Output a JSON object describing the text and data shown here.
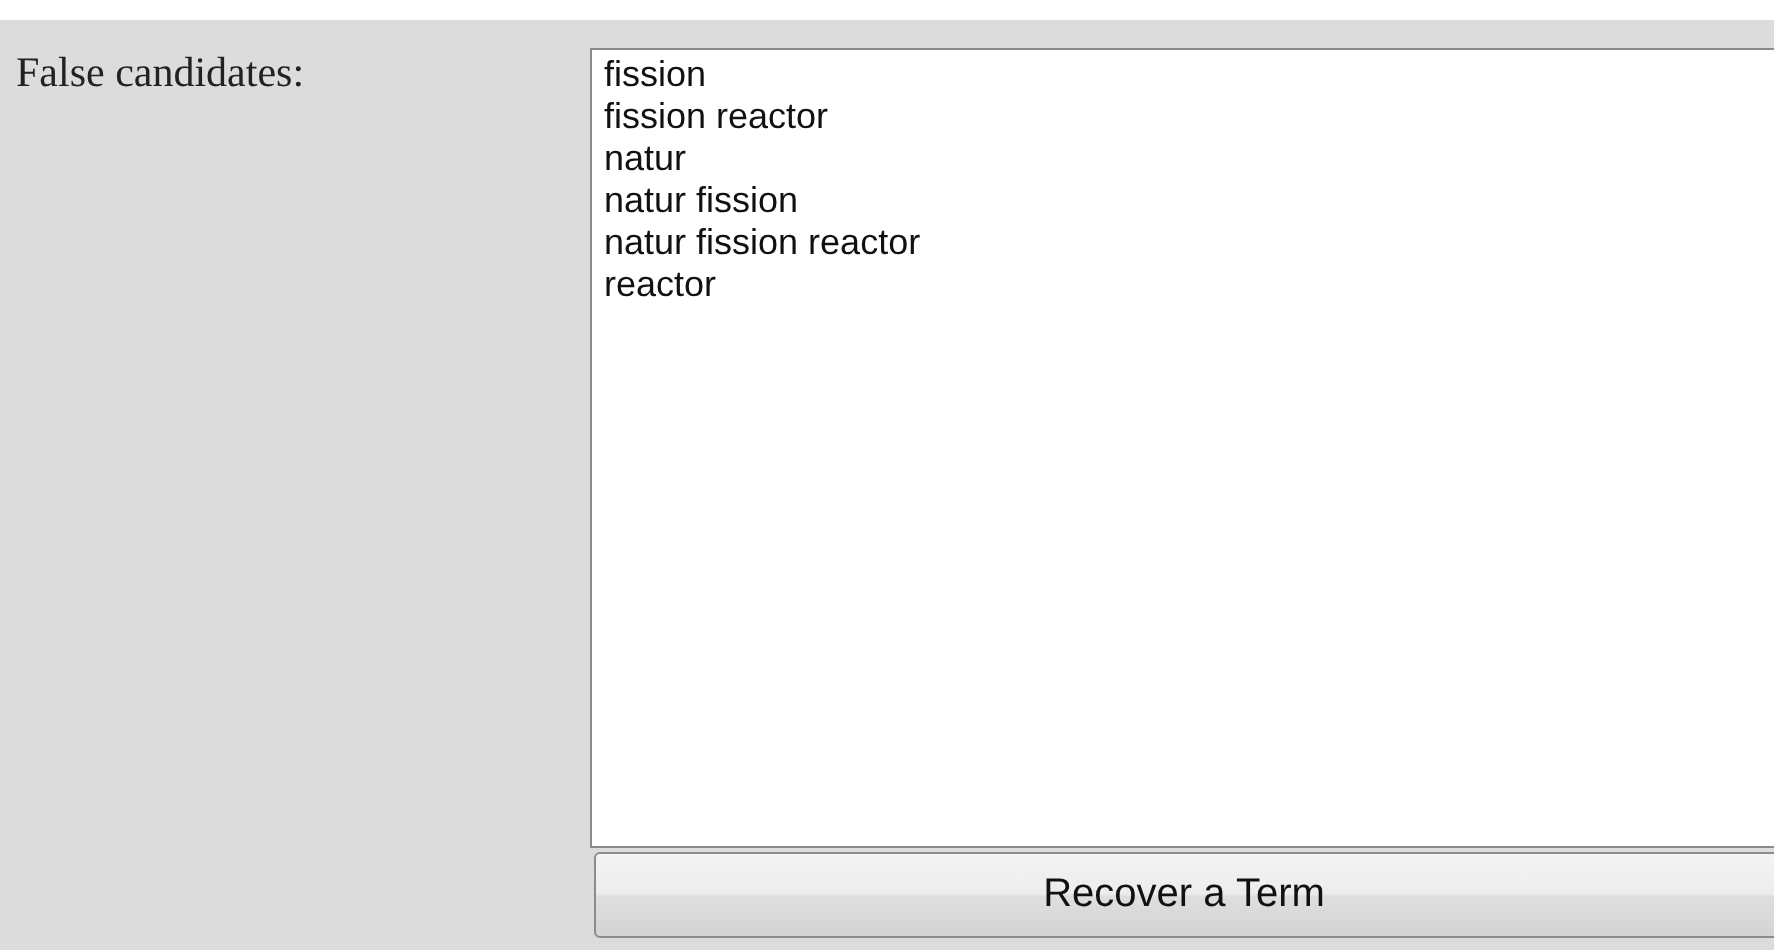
{
  "label": "False candidates:",
  "candidates": [
    {
      "text": "fission",
      "selected": false
    },
    {
      "text": "fission reactor",
      "selected": false
    },
    {
      "text": "natur",
      "selected": false
    },
    {
      "text": "natur fission",
      "selected": false
    },
    {
      "text": "natur fission reactor",
      "selected": false
    },
    {
      "text": "reactor",
      "selected": false
    }
  ],
  "button": "Recover a Term"
}
